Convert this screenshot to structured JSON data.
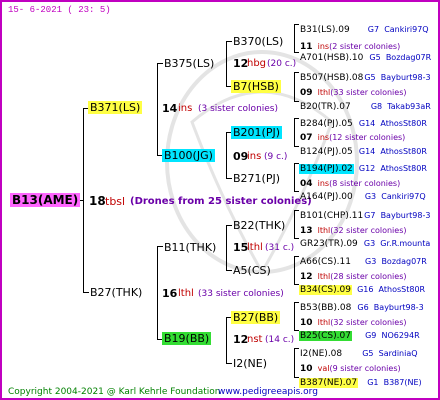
{
  "header": {
    "date": "15-  6-2021 (  23:  5)"
  },
  "footer": {
    "copyright": "Copyright 2004-2021 @ Karl Kehrle Foundation",
    "url": "www.pedigreeapis.org"
  },
  "root": {
    "name": "B13(AME)"
  },
  "drones": {
    "num": "18",
    "ins": "tbsl",
    "label": "(Drones from 25 sister colonies)"
  },
  "gen1": [
    {
      "name": "B371(LS)",
      "num": "14",
      "ins": "ins",
      "sis": "(3 sister colonies)"
    },
    {
      "name": "B27(THK)",
      "num": "16",
      "ins": "lthl",
      "sis": "(33 sister colonies)"
    }
  ],
  "gen2": [
    {
      "name": "B375(LS)",
      "num": "12",
      "ins": "hbg",
      "sis": "(20 c.)"
    },
    {
      "name": "B100(JG)",
      "num": "09",
      "ins": "ins",
      "sis": "(9 c.)"
    },
    {
      "name": "B11(THK)",
      "num": "15",
      "ins": "lthl",
      "sis": "(31 c.)"
    },
    {
      "name": "B19(BB)",
      "num": "12",
      "ins": "nst",
      "sis": "(14 c.)"
    }
  ],
  "gen3": [
    {
      "name": "B370(LS)",
      "num": "11",
      "ins": "ins",
      "sis": "(2 sister colonies)"
    },
    {
      "name": "B7(HSB)",
      "num": "09",
      "ins": "lthl",
      "sis": "(33 sister colonies)"
    },
    {
      "name": "B201(PJ)",
      "num": "07",
      "ins": "ins",
      "sis": "(12 sister colonies)"
    },
    {
      "name": "B271(PJ)",
      "num": "04",
      "ins": "ins",
      "sis": "(8 sister colonies)"
    },
    {
      "name": "B22(THK)",
      "num": "13",
      "ins": "lthl",
      "sis": "(32 sister colonies)"
    },
    {
      "name": "A5(CS)",
      "num": "12",
      "ins": "lthl",
      "sis": "(28 sister colonies)"
    },
    {
      "name": "B27(BB)",
      "num": "10",
      "ins": "lthl",
      "sis": "(32 sister colonies)"
    },
    {
      "name": "I2(NE)",
      "num": "10",
      "ins": "val",
      "sis": "(9 sister colonies)"
    }
  ],
  "gen4": [
    {
      "name": "B31(LS).09",
      "gen": "G7",
      "loc": "Cankiri97Q"
    },
    {
      "name": "A701(HSB).10",
      "gen": "G5",
      "loc": "Bozdag07R"
    },
    {
      "name": "B507(HSB).08",
      "gen": "G5",
      "loc": "Bayburt98-3"
    },
    {
      "name": "B20(TR).07",
      "gen": "G8",
      "loc": "Takab93aR"
    },
    {
      "name": "B284(PJ).05",
      "gen": "G14",
      "loc": "AthosSt80R"
    },
    {
      "name": "B124(PJ).05",
      "gen": "G14",
      "loc": "AthosSt80R"
    },
    {
      "name": "B194(PJ).02",
      "gen": "G12",
      "loc": "AthosSt80R"
    },
    {
      "name": "A164(PJ).00",
      "gen": "G3",
      "loc": "Cankiri97Q"
    },
    {
      "name": "B101(CHP).11",
      "gen": "G7",
      "loc": "Bayburt98-3"
    },
    {
      "name": "GR23(TR).09",
      "gen": "G3",
      "loc": "Gr.R.mounta"
    },
    {
      "name": "A66(CS).11",
      "gen": "G3",
      "loc": "Bozdag07R"
    },
    {
      "name": "B34(CS).09",
      "gen": "G16",
      "loc": "AthosSt80R"
    },
    {
      "name": "B53(BB).08",
      "gen": "G6",
      "loc": "Bayburt98-3"
    },
    {
      "name": "B25(CS).07",
      "gen": "G9",
      "loc": "NO6294R"
    },
    {
      "name": "I2(NE).08",
      "gen": "G5",
      "loc": "SardiniaQ"
    },
    {
      "name": "B387(NE).07",
      "gen": "G1",
      "loc": "B387(NE)"
    }
  ]
}
